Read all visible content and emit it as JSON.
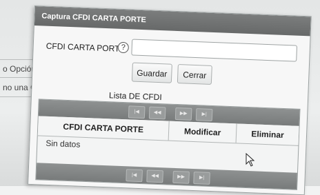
{
  "background": {
    "lines": [
      "o Opción",
      "no una C"
    ]
  },
  "dialog": {
    "title": "Captura CFDI CARTA PORTE",
    "field_label": "CFDI CARTA PORTE",
    "help_glyph": "?",
    "input_value": "",
    "save_label": "Guardar",
    "close_label": "Cerrar",
    "list_title": "Lista DE CFDI",
    "pager": [
      "|◀",
      "◀◀",
      "▶▶",
      "▶|"
    ],
    "columns": [
      "CFDI CARTA PORTE",
      "Modificar",
      "Eliminar"
    ],
    "empty_text": "Sin datos"
  },
  "colors": {
    "titlebar": "#6f7171",
    "pager": "#828585",
    "dialog_bg": "#f7f7f7"
  }
}
